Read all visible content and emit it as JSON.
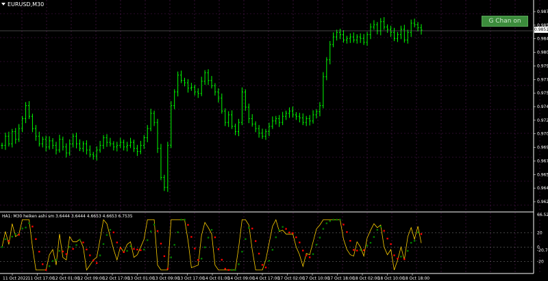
{
  "window": {
    "symbol_label": "EURUSD,M30"
  },
  "button": {
    "label": "G Chan on"
  },
  "current_price": "0.98510",
  "price_axis": {
    "labels": [
      "0.98745",
      "0.98580",
      "0.98415",
      "0.98085",
      "0.97920",
      "0.97750",
      "0.97585",
      "0.97420",
      "0.97255",
      "0.97090",
      "0.96925",
      "0.96760",
      "0.96595",
      "0.96430",
      "0.96265"
    ],
    "min": 0.962,
    "max": 0.9885
  },
  "subwindow": {
    "label": "HA1: M30 heiken ashi sm 3.6444 3.6444 4.6653 4.6653 6.7535",
    "scale_labels": [
      "66.5299",
      "20",
      "0",
      "-20",
      "-20.7497"
    ],
    "min": -35,
    "max": 45
  },
  "time_axis": {
    "labels": [
      "11 Oct 2022",
      "11 Oct 17:00",
      "12 Oct 01:00",
      "12 Oct 09:00",
      "12 Oct 17:00",
      "13 Oct 01:00",
      "13 Oct 09:00",
      "13 Oct 17:00",
      "14 Oct 01:00",
      "14 Oct 09:00",
      "14 Oct 17:00",
      "17 Oct 02:00",
      "17 Oct 10:00",
      "17 Oct 18:00",
      "18 Oct 02:00",
      "18 Oct 10:00",
      "18 Oct 18:00"
    ]
  },
  "colors": {
    "background": "#000000",
    "grid": "#5a1a5a",
    "candles": "#00ff00",
    "osc_line": "#ffd000",
    "osc_up": "#008000",
    "osc_down": "#ff0000",
    "axis_text": "#ffffff",
    "button_bg": "#3c8c3c"
  },
  "chart_data": {
    "type": "line",
    "title": "EURUSD,M30",
    "series": [
      {
        "name": "EURUSD,M30",
        "values": [
          0.97,
          0.9712,
          0.9702,
          0.9718,
          0.9708,
          0.9722,
          0.9735,
          0.9752,
          0.9738,
          0.9722,
          0.9712,
          0.9702,
          0.9708,
          0.9698,
          0.9706,
          0.97,
          0.9694,
          0.9708,
          0.9698,
          0.969,
          0.9702,
          0.9712,
          0.9702,
          0.9696,
          0.9702,
          0.9694,
          0.9688,
          0.9686,
          0.9694,
          0.97,
          0.971,
          0.9704,
          0.9702,
          0.9698,
          0.97,
          0.9704,
          0.9698,
          0.97,
          0.9704,
          0.9696,
          0.9692,
          0.97,
          0.971,
          0.9722,
          0.9742,
          0.973,
          0.9696,
          0.9658,
          0.9645,
          0.97,
          0.9752,
          0.977,
          0.9792,
          0.9785,
          0.9782,
          0.9775,
          0.9776,
          0.977,
          0.9768,
          0.9784,
          0.9795,
          0.9785,
          0.9778,
          0.977,
          0.9762,
          0.9745,
          0.973,
          0.974,
          0.9725,
          0.9718,
          0.973,
          0.977,
          0.975,
          0.9735,
          0.9728,
          0.9722,
          0.9716,
          0.9712,
          0.9718,
          0.9725,
          0.9732,
          0.9735,
          0.973,
          0.9738,
          0.9742,
          0.9745,
          0.974,
          0.9738,
          0.9736,
          0.973,
          0.9735,
          0.9732,
          0.974,
          0.9744,
          0.9752,
          0.979,
          0.9812,
          0.9832,
          0.9842,
          0.9848,
          0.9845,
          0.9838,
          0.984,
          0.9842,
          0.9838,
          0.9842,
          0.984,
          0.9835,
          0.9845,
          0.9855,
          0.9858,
          0.985,
          0.9862,
          0.9855,
          0.9852,
          0.9848,
          0.984,
          0.9845,
          0.9852,
          0.9838,
          0.9848,
          0.986,
          0.9858,
          0.9854,
          0.9851
        ]
      }
    ],
    "ylim": [
      0.962,
      0.9885
    ]
  }
}
